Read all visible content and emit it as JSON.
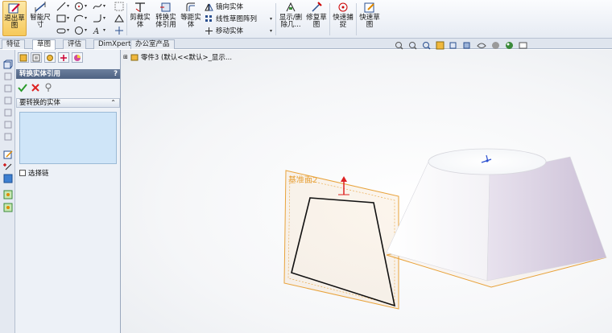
{
  "ribbon": {
    "exit_sketch": "退出草\n图",
    "smart_dim": "智能尺\n寸",
    "trim": "剪裁实\n体",
    "convert": "转换实\n体引用",
    "offset": "等距实\n体",
    "mirror": "镜向实体",
    "linear_pattern": "线性草图阵列",
    "move": "移动实体",
    "display_delete": "显示/删\n除几...",
    "repair": "修复草\n图",
    "quick_snap": "快速捕\n捉",
    "rapid_sketch": "快速草\n图"
  },
  "tabs": [
    "特征",
    "草图",
    "评估",
    "DimXpert",
    "办公室产品"
  ],
  "active_tab": "草图",
  "pm": {
    "title": "转换实体引用",
    "help": "?",
    "section": "要转换的实体",
    "checkbox_label": "选择链"
  },
  "tree": {
    "label": "零件3 (默认<<默认>_显示..."
  },
  "viewport": {
    "plane_label": "基准面2"
  },
  "colors": {
    "plane_orange": "#e8a23a",
    "frustum_side": "#cfc6d6"
  }
}
